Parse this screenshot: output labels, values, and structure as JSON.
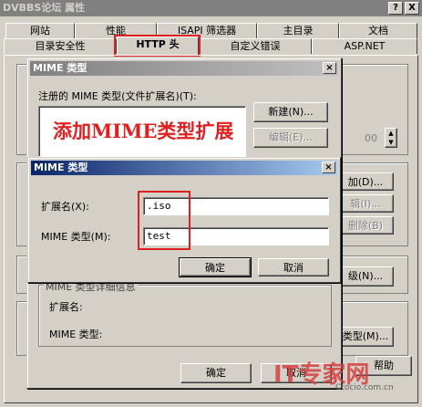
{
  "window": {
    "title": "DVBBS论坛 属性",
    "help_btn": "?",
    "close_btn": "X"
  },
  "tabs_row1": [
    "网站",
    "性能",
    "ISAPI 筛选器",
    "主目录",
    "文档"
  ],
  "tabs_row2": [
    "目录安全性",
    "HTTP 头",
    "自定义错误",
    "ASP.NET"
  ],
  "partial": {
    "spin_value": "00",
    "add_btn": "加(D)...",
    "edit_btn": "辑(I)...",
    "delete_btn": "删除(B)",
    "grade_btn": "级(N)...",
    "type_btn": "类型(M)...",
    "help_btn": "帮助"
  },
  "mime_dialog": {
    "title": "MIME 类型",
    "registered_label": "注册的 MIME 类型(文件扩展名)(T):",
    "new_btn": "新建(N)...",
    "edit_btn": "编辑(E)...",
    "annotation": "添加MIME类型扩展",
    "details_group": "MIME 类型详细信息",
    "ext_label": "扩展名:",
    "mime_label": "MIME 类型:",
    "ok_btn": "确定",
    "cancel_btn": "取消"
  },
  "inner_dialog": {
    "title": "MIME 类型",
    "ext_label": "扩展名(X):",
    "ext_value": ".iso",
    "mime_label": "MIME 类型(M):",
    "mime_value": "test",
    "ok_btn": "确定",
    "cancel_btn": "取消"
  },
  "watermark": {
    "brand": "IT专家网",
    "site": "Ctocio.com.cn"
  },
  "colors": {
    "title_active": "#0a246a",
    "title_gradient_end": "#a6caf0",
    "title_inactive": "#808080",
    "annotation": "#e02020"
  }
}
